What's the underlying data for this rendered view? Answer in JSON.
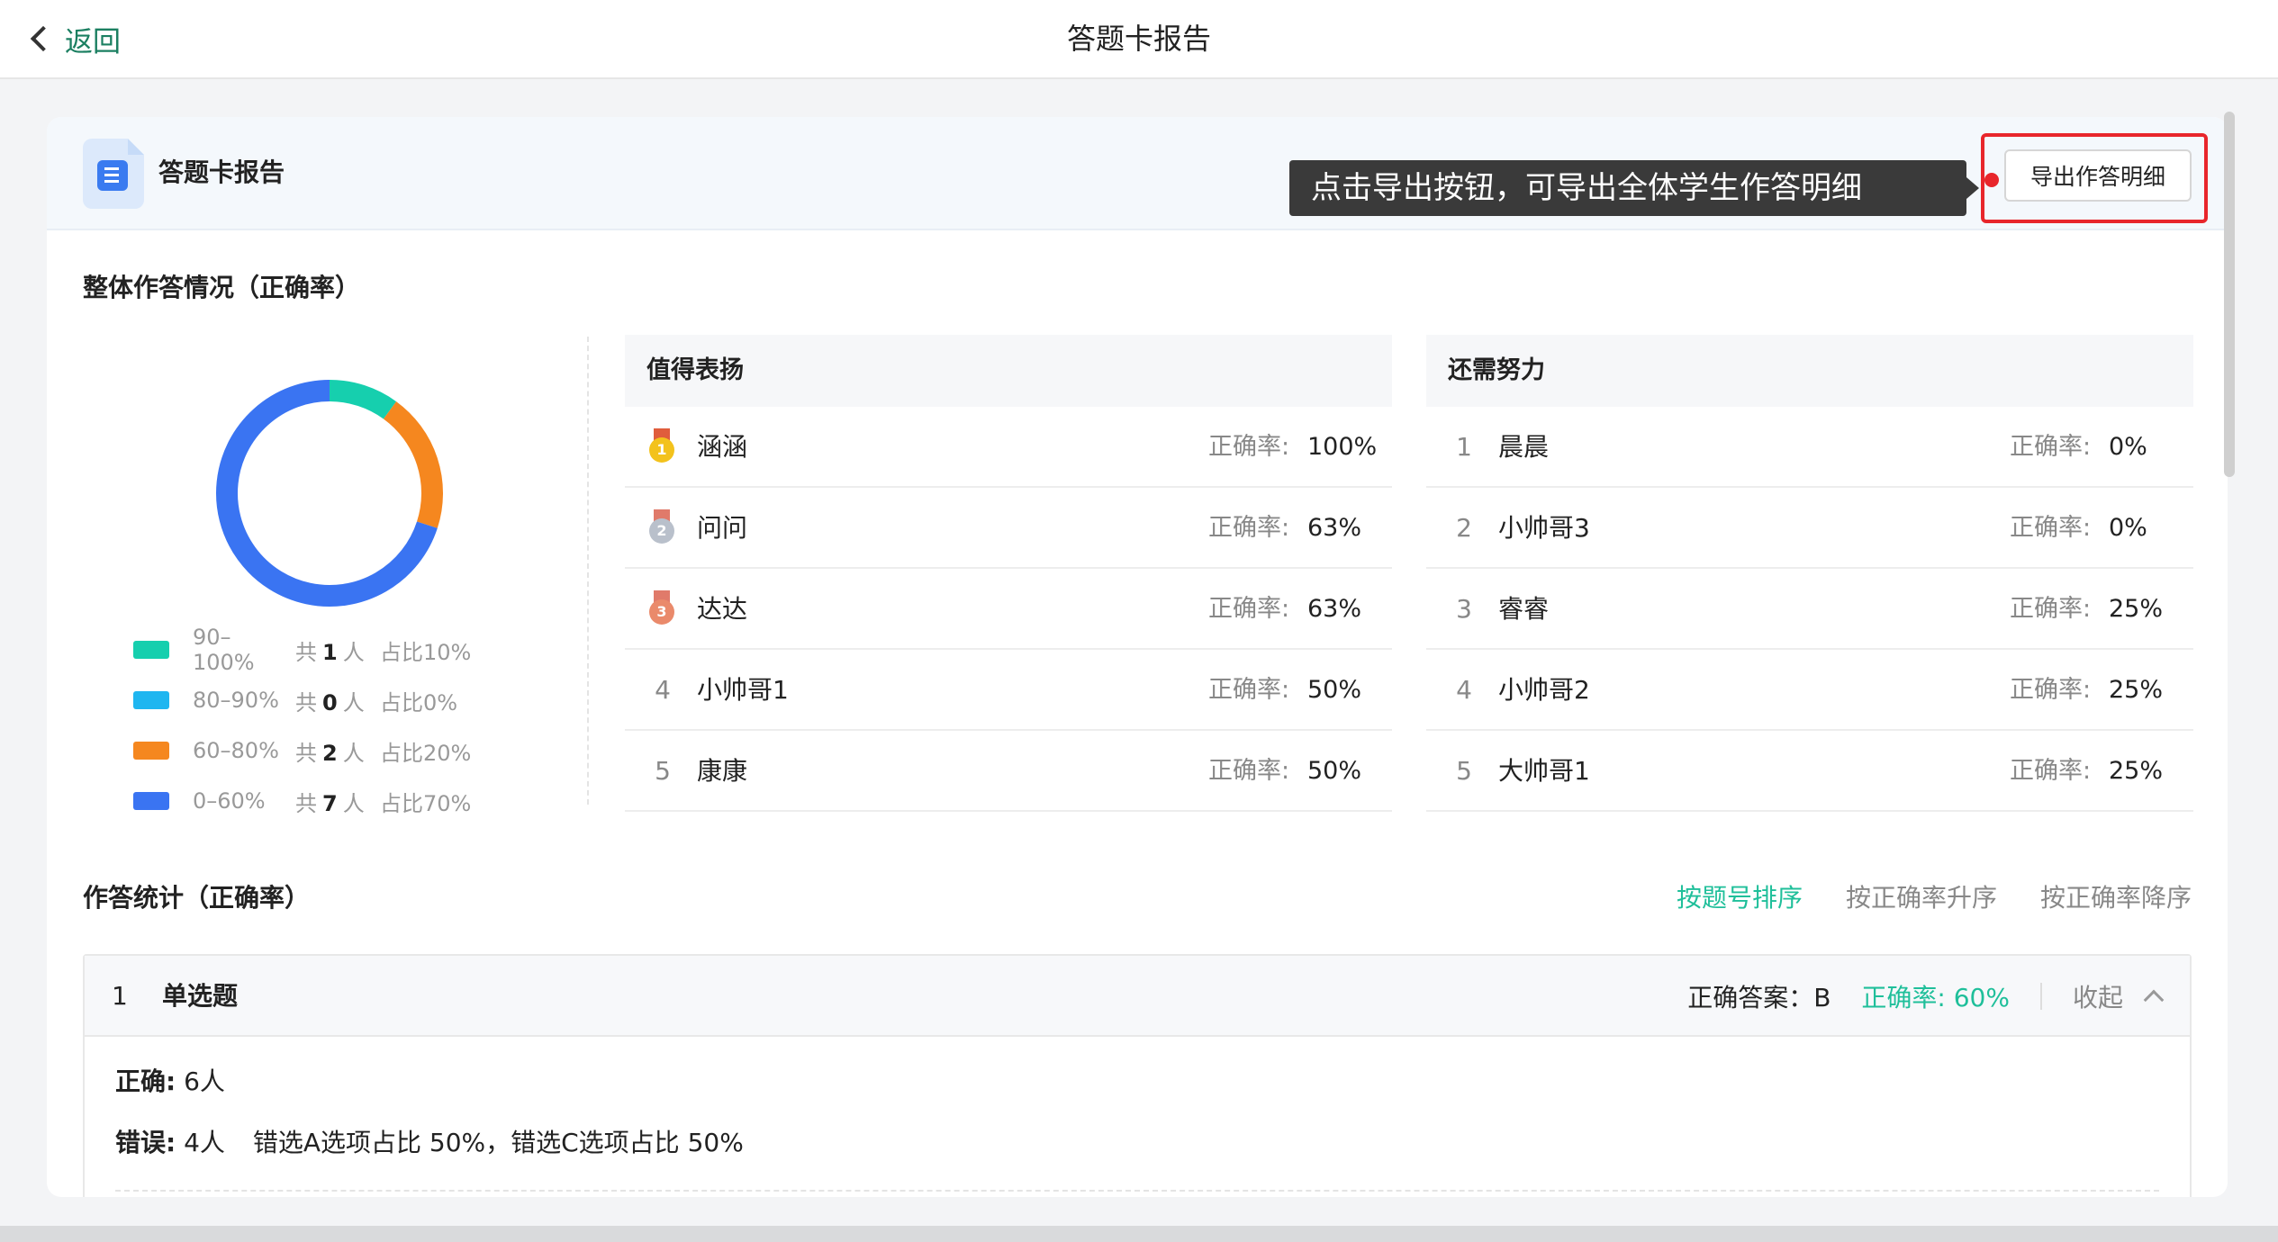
{
  "nav": {
    "back_label": "返回",
    "title": "答题卡报告"
  },
  "card": {
    "title": "答题卡报告",
    "tooltip": "点击导出按钮，可导出全体学生作答明细",
    "export_label": "导出作答明细"
  },
  "overall": {
    "title": "整体作答情况（正确率）",
    "chart_data": {
      "type": "pie",
      "categories": [
        "90-100%",
        "80-90%",
        "60-80%",
        "0-60%"
      ],
      "values": [
        10,
        0,
        20,
        70
      ],
      "colors": [
        "#16cfae",
        "#1fb6f0",
        "#f5871f",
        "#3a74f2"
      ]
    },
    "legend": [
      {
        "range": "90–100%",
        "count_prefix": "共",
        "count": "1",
        "count_suffix": "人",
        "pct": "占比10%",
        "color": "#16cfae"
      },
      {
        "range": "80–90%",
        "count_prefix": "共",
        "count": "0",
        "count_suffix": "人",
        "pct": "占比0%",
        "color": "#1fb6f0"
      },
      {
        "range": "60–80%",
        "count_prefix": "共",
        "count": "2",
        "count_suffix": "人",
        "pct": "占比20%",
        "color": "#f5871f"
      },
      {
        "range": "0–60%",
        "count_prefix": "共",
        "count": "7",
        "count_suffix": "人",
        "pct": "占比70%",
        "color": "#3a74f2"
      }
    ]
  },
  "praise": {
    "title": "值得表扬",
    "acc_label": "正确率:",
    "rows": [
      {
        "rank": "1",
        "name": "涵涵",
        "acc": "100%",
        "medal": "gold"
      },
      {
        "rank": "2",
        "name": "问问",
        "acc": "63%",
        "medal": "silver"
      },
      {
        "rank": "3",
        "name": "达达",
        "acc": "63%",
        "medal": "bronze"
      },
      {
        "rank": "4",
        "name": "小帅哥1",
        "acc": "50%"
      },
      {
        "rank": "5",
        "name": "康康",
        "acc": "50%"
      }
    ]
  },
  "improve": {
    "title": "还需努力",
    "acc_label": "正确率:",
    "rows": [
      {
        "rank": "1",
        "name": "晨晨",
        "acc": "0%"
      },
      {
        "rank": "2",
        "name": "小帅哥3",
        "acc": "0%"
      },
      {
        "rank": "3",
        "name": "睿睿",
        "acc": "25%"
      },
      {
        "rank": "4",
        "name": "小帅哥2",
        "acc": "25%"
      },
      {
        "rank": "5",
        "name": "大帅哥1",
        "acc": "25%"
      }
    ]
  },
  "stats": {
    "title": "作答统计（正确率）",
    "sort": [
      "按题号排序",
      "按正确率升序",
      "按正确率降序"
    ],
    "active_sort": "按题号排序"
  },
  "question": {
    "num": "1",
    "type": "单选题",
    "answer": "正确答案：B",
    "rate": "正确率: 60%",
    "fold_label": "收起",
    "correct_label": "正确:",
    "correct_value": "6人",
    "wrong_label": "错误:",
    "wrong_value": "4人",
    "wrong_detail": "错选A选项占比 50%，错选C选项占比 50%"
  },
  "colors": {
    "accent": "#1fbf9a",
    "highlight": "#e8262b"
  }
}
